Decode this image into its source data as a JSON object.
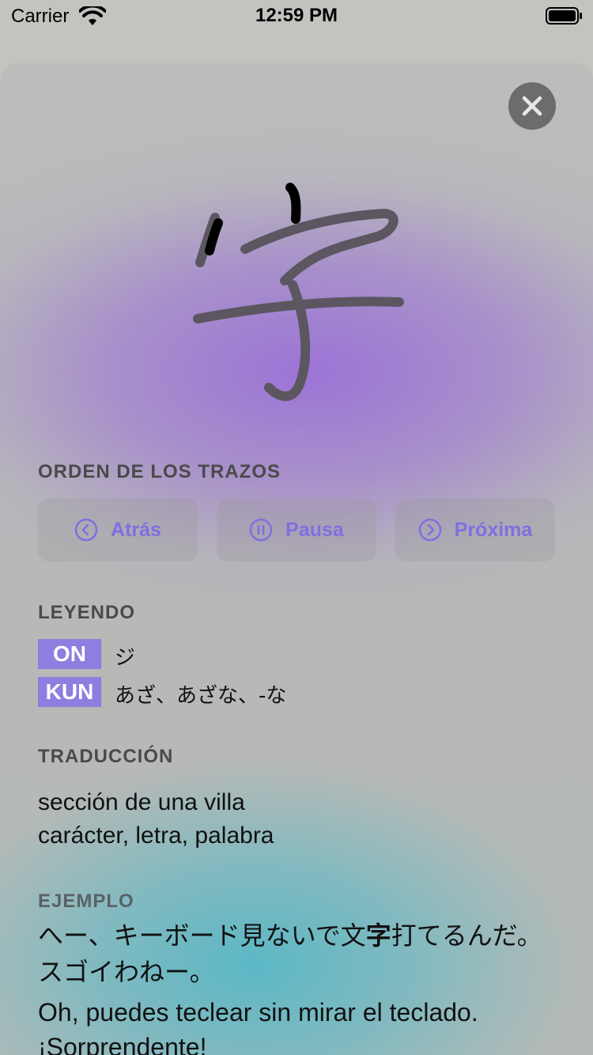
{
  "status_bar": {
    "carrier": "Carrier",
    "time": "12:59 PM"
  },
  "kanji": {
    "character": "字"
  },
  "stroke_order": {
    "label": "ORDEN DE LOS TRAZOS",
    "back_label": "Atrás",
    "pause_label": "Pausa",
    "next_label": "Próxima"
  },
  "reading": {
    "label": "LEYENDO",
    "on_tag": "ON",
    "on_text": "ジ",
    "kun_tag": "KUN",
    "kun_text": "あざ、あざな、-な"
  },
  "translation": {
    "label": "TRADUCCIÓN",
    "line1": "sección de una villa",
    "line2": "carácter, letra, palabra"
  },
  "example": {
    "label": "EJEMPLO",
    "jp_before": "へー、キーボード見ないで文",
    "jp_highlight": "字",
    "jp_after": "打てるんだ。スゴイわねー。",
    "es": "Oh, puedes teclear sin mirar el teclado. ¡Sorprendente!"
  },
  "colors": {
    "accent": "#8d7ee0",
    "button_text": "#7f6fe0",
    "close_bg": "#6c6c6c"
  }
}
